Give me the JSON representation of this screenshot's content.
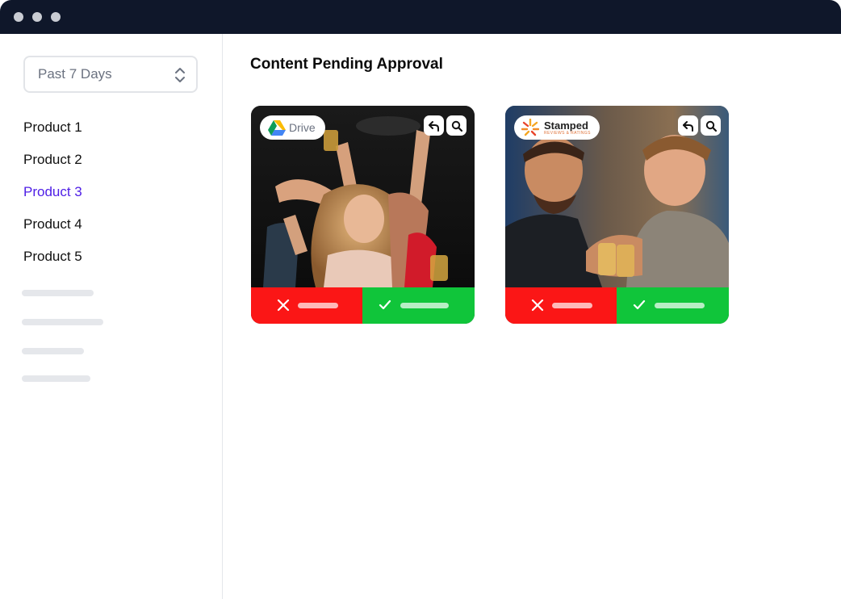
{
  "sidebar": {
    "date_filter": {
      "value": "Past 7 Days"
    },
    "items": [
      {
        "label": "Product 1",
        "active": false
      },
      {
        "label": "Product 2",
        "active": false
      },
      {
        "label": "Product 3",
        "active": true
      },
      {
        "label": "Product 4",
        "active": false
      },
      {
        "label": "Product 5",
        "active": false
      }
    ]
  },
  "main": {
    "title": "Content Pending Approval",
    "cards": [
      {
        "source_label": "Drive",
        "source_icon": "google-drive-icon"
      },
      {
        "source_label": "Stamped",
        "source_sublabel": "REVIEWS & RATINGS",
        "source_icon": "stamped-logo-icon"
      }
    ]
  },
  "colors": {
    "titlebar": "#0f172a",
    "active_nav": "#4f1fe6",
    "reject": "#fb1616",
    "approve": "#10c53a"
  }
}
